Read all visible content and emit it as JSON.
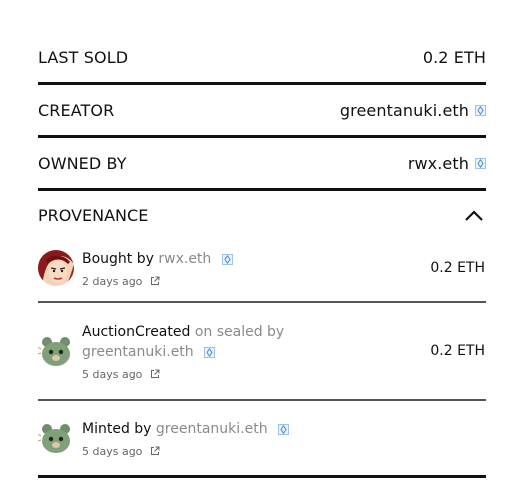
{
  "details": {
    "last_sold": {
      "label": "LAST SOLD",
      "value": "0.2 ETH"
    },
    "creator": {
      "label": "CREATOR",
      "value": "greentanuki.eth"
    },
    "owned_by": {
      "label": "OWNED BY",
      "value": "rwx.eth"
    }
  },
  "provenance": {
    "title": "PROVENANCE",
    "events": [
      {
        "action": "Bought by",
        "user": "rwx.eth",
        "time": "2 days ago",
        "price": "0.2 ETH",
        "avatar": "portrait-avatar"
      },
      {
        "action": "AuctionCreated",
        "middle": "on sealed by",
        "user": "greentanuki.eth",
        "time": "5 days ago",
        "price": "0.2 ETH",
        "avatar": "tanuki-avatar"
      },
      {
        "action": "Minted by",
        "user": "greentanuki.eth",
        "time": "5 days ago",
        "avatar": "tanuki-avatar"
      }
    ]
  },
  "icons": [
    "ens-badge-icon",
    "external-link-icon",
    "chevron-up-icon"
  ],
  "colors": {
    "divider": "#111111",
    "muted_text": "#8a8a8a",
    "badge_border": "#9fc3e8"
  }
}
